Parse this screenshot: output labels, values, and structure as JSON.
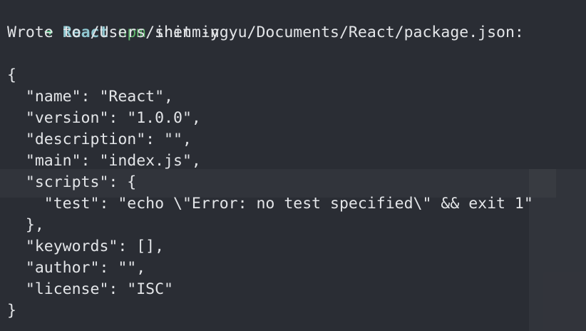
{
  "colors": {
    "background": "#2a2d34",
    "text": "#e3e5e8",
    "prompt_arrow": "#5fd38d",
    "prompt_dir": "#8fc7d0",
    "command": "#5fb86c"
  },
  "prompt": {
    "arrow": "➜",
    "dir": "React",
    "command": "npm",
    "args": "init -y"
  },
  "output": {
    "wrote_line": "Wrote to /Users/shenmingyu/Documents/React/package.json:",
    "json_lines": [
      "{",
      "  \"name\": \"React\",",
      "  \"version\": \"1.0.0\",",
      "  \"description\": \"\",",
      "  \"main\": \"index.js\",",
      "  \"scripts\": {",
      "    \"test\": \"echo \\\"Error: no test specified\\\" && exit 1\"",
      "  },",
      "  \"keywords\": [],",
      "  \"author\": \"\",",
      "  \"license\": \"ISC\"",
      "}"
    ]
  }
}
